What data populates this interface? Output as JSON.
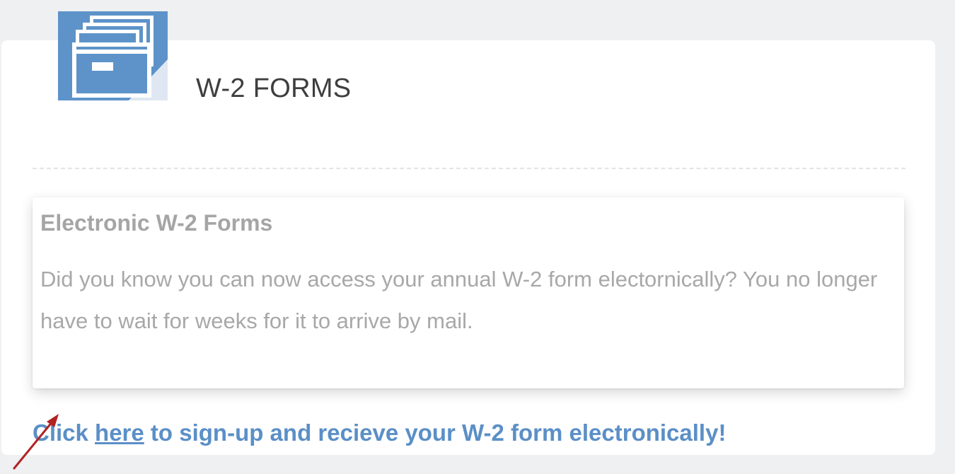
{
  "header": {
    "title": "W-2 FORMS",
    "icon": "file-cabinet-icon",
    "icon_color": "#5d93c9"
  },
  "info_box": {
    "title": "Electronic W-2 Forms",
    "body": "Did you know you can now access your annual W-2 form electornically? You no longer have to wait for weeks for it to arrive by mail."
  },
  "cta": {
    "prefix": "Click ",
    "link_text": "here",
    "suffix": " to sign-up and recieve your W-2 form electronically!",
    "color": "#5b8fc7"
  },
  "annotation": {
    "icon": "pointer-arrow-icon",
    "color": "#b22222"
  }
}
